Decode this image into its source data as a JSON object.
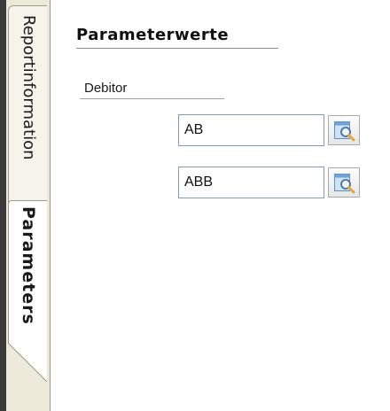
{
  "tabs": [
    {
      "label": "Reportinformation",
      "active": false
    },
    {
      "label": "Parameters",
      "active": true
    }
  ],
  "panel": {
    "title": "Parameterwerte",
    "field_label": "Debitor",
    "values": [
      "AB",
      "ABB"
    ]
  },
  "icons": {
    "lookup": "lookup-magnifier-icon"
  },
  "colors": {
    "tab_strip": "#ece9d8",
    "input_border": "#7f9db9",
    "icon_blue": "#6fa3d6",
    "icon_orange": "#e8a53a"
  }
}
